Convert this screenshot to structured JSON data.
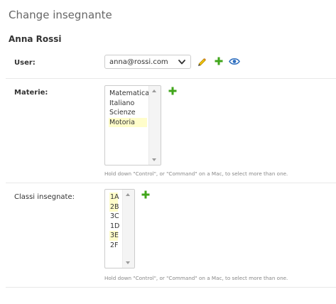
{
  "page": {
    "title": "Change insegnante"
  },
  "fieldset": {
    "title": "Anna Rossi"
  },
  "user_field": {
    "label": "User:",
    "value": "anna@rossi.com",
    "icons": [
      "pencil-icon",
      "plus-icon",
      "eye-icon"
    ],
    "colors": {
      "pencil": "#e5b300",
      "plus": "#41a61b",
      "eye": "#2f6fbf"
    }
  },
  "materie_field": {
    "label": "Materie:",
    "options": [
      {
        "label": "Matematica",
        "selected": false
      },
      {
        "label": "Italiano",
        "selected": false
      },
      {
        "label": "Scienze",
        "selected": false
      },
      {
        "label": "Motoria",
        "selected": true
      }
    ],
    "help": "Hold down \"Control\", or \"Command\" on a Mac, to select more than one."
  },
  "classi_field": {
    "label": "Classi insegnate:",
    "options": [
      {
        "label": "1A",
        "selected": true
      },
      {
        "label": "2B",
        "selected": true
      },
      {
        "label": "3C",
        "selected": false
      },
      {
        "label": "1D",
        "selected": false
      },
      {
        "label": "3E",
        "selected": true
      },
      {
        "label": "2F",
        "selected": false
      }
    ],
    "help": "Hold down \"Control\", or \"Command\" on a Mac, to select more than one."
  },
  "colors": {
    "selected_option_bg": "#fffdca",
    "help_text": "#888888",
    "title_text": "#666666"
  }
}
